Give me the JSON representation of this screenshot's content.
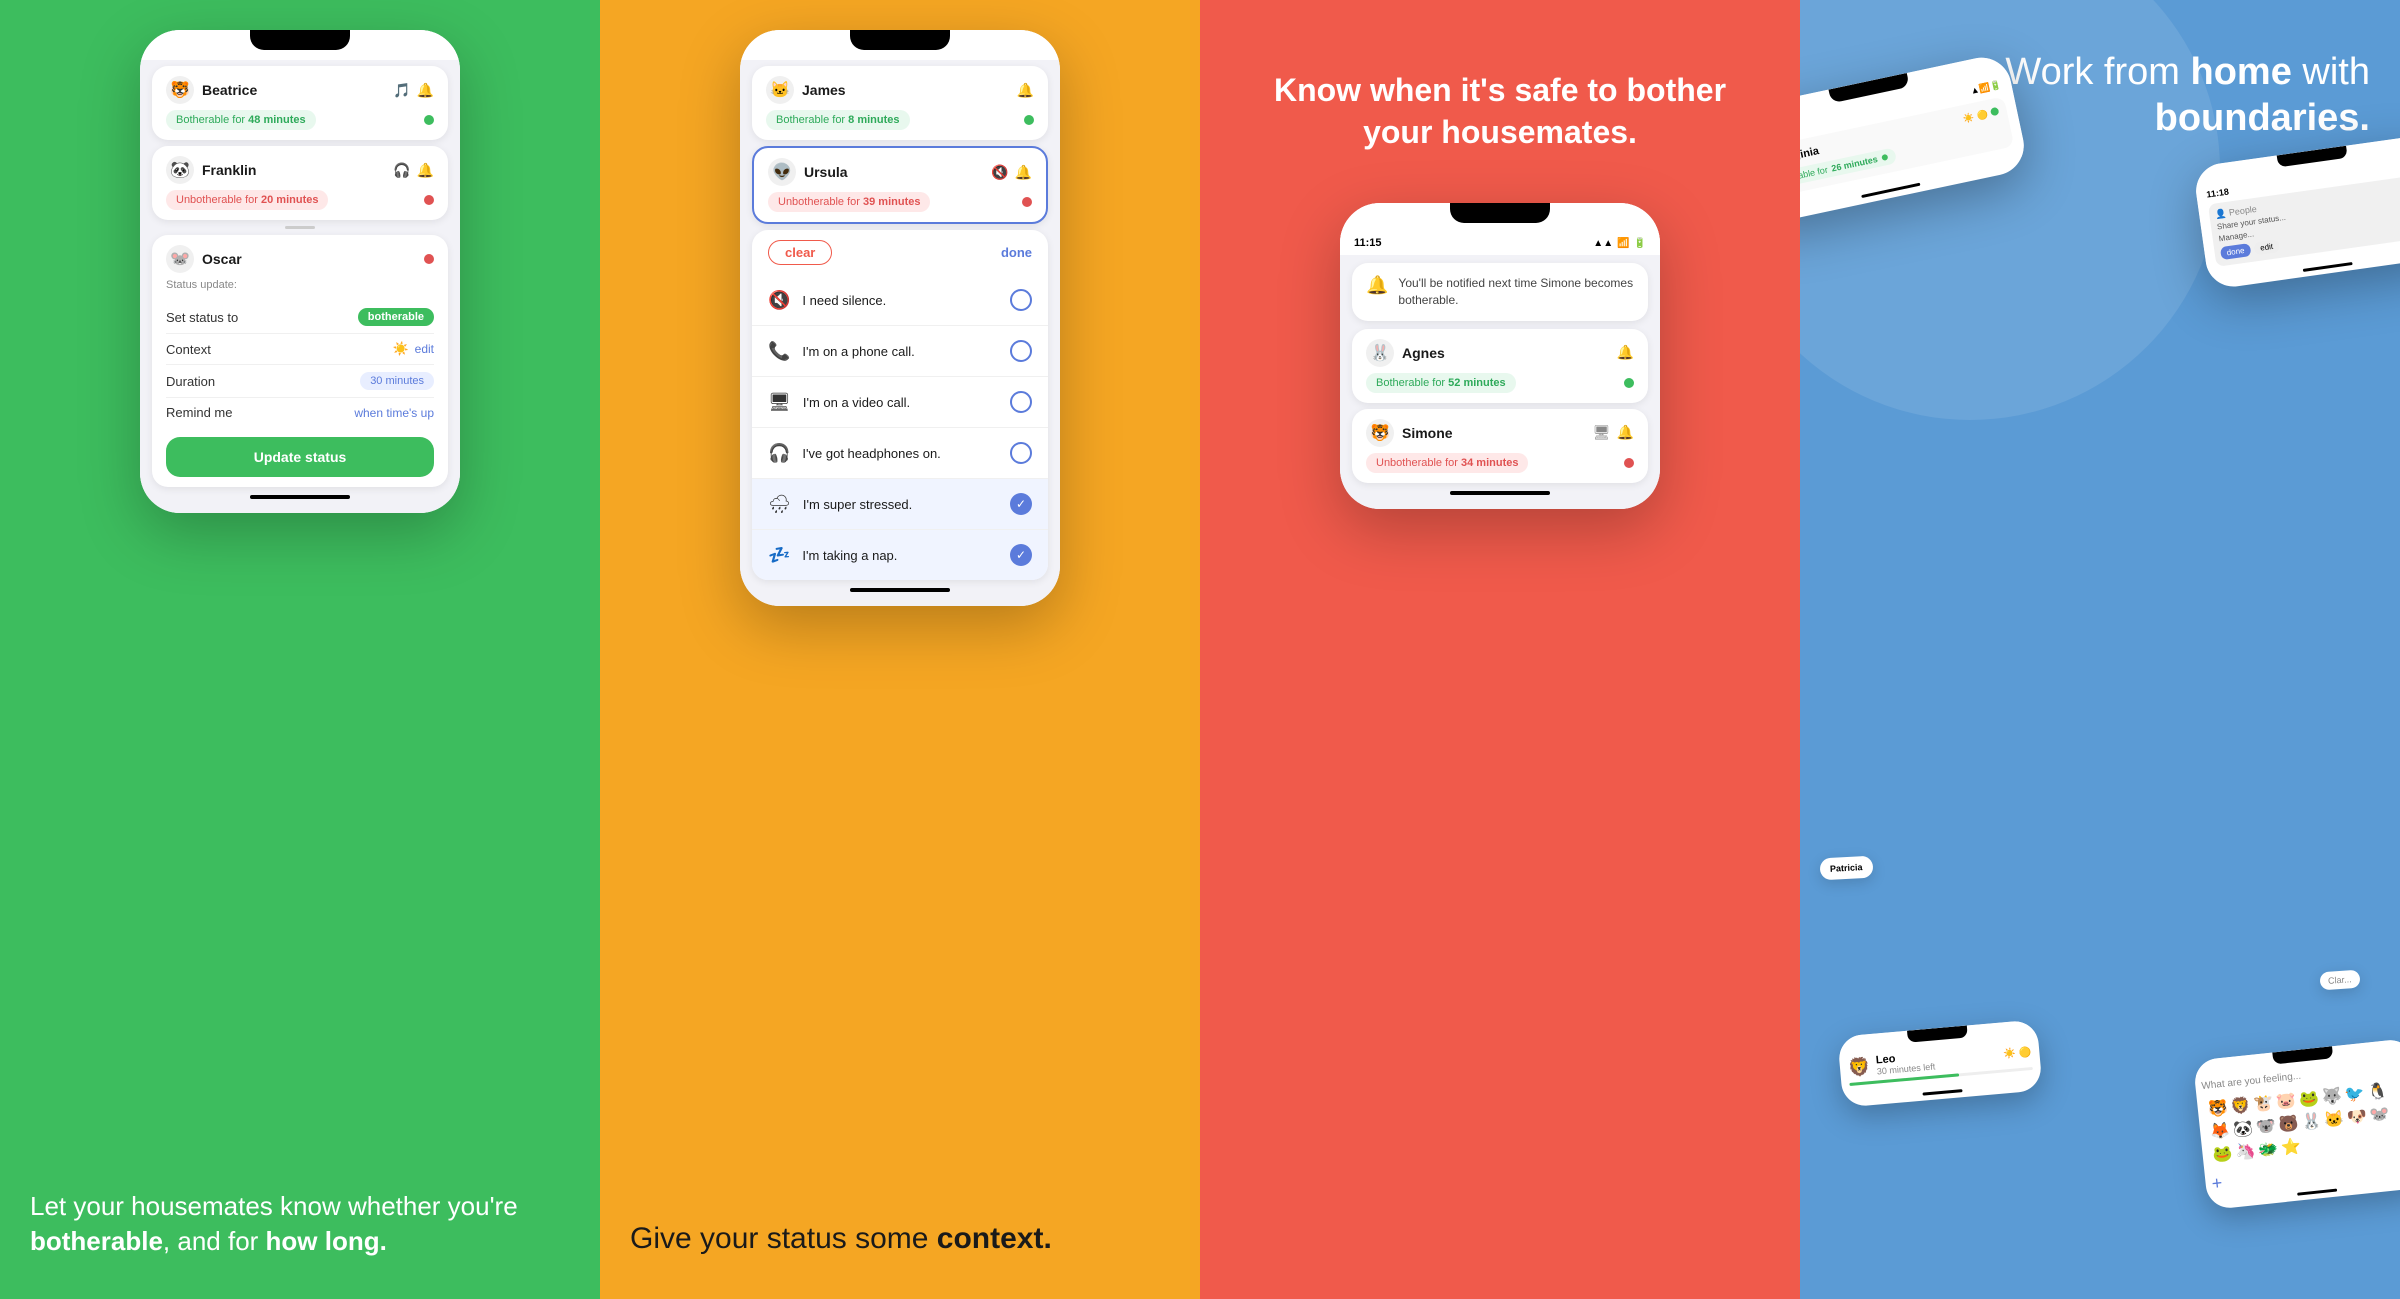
{
  "panels": [
    {
      "id": "panel-1",
      "bg": "#3DBD5E",
      "caption": {
        "text_plain": "Let your housemates know whether you're ",
        "text_bold_1": "botherable",
        "text_mid": ", and for ",
        "text_bold_2": "how long."
      },
      "phone": {
        "contacts": [
          {
            "name": "Beatrice",
            "avatar": "🐯",
            "status": "botherable",
            "duration": "48 minutes",
            "icons": [
              "🎵",
              "🔔"
            ]
          },
          {
            "name": "Franklin",
            "avatar": "🐼",
            "status": "unbotherable",
            "duration": "20 minutes",
            "icons": [
              "🎧",
              "🔔"
            ]
          }
        ],
        "form": {
          "label": "Status update:",
          "set_status_label": "Set status to",
          "set_status_value": "botherable",
          "context_label": "Context",
          "context_icon": "☀️",
          "context_action": "edit",
          "duration_label": "Duration",
          "duration_value": "30 minutes",
          "remind_label": "Remind me",
          "remind_value": "when time's up",
          "update_btn": "Update status"
        },
        "oscar": {
          "name": "Oscar",
          "avatar": "🐭"
        }
      }
    },
    {
      "id": "panel-2",
      "bg": "#F5A623",
      "caption": {
        "text_plain": "Give your status some ",
        "text_bold": "context."
      },
      "phone": {
        "top_contact": {
          "name": "James",
          "avatar": "🐱",
          "status": "botherable",
          "duration": "8 minutes"
        },
        "bottom_contact": {
          "name": "Ursula",
          "avatar": "👽",
          "status": "unbotherable",
          "duration": "39 minutes"
        },
        "clear_btn": "clear",
        "done_btn": "done",
        "context_items": [
          {
            "icon": "🔇",
            "text": "I need silence.",
            "checked": false
          },
          {
            "icon": "📞",
            "text": "I'm on a phone call.",
            "checked": false
          },
          {
            "icon": "🖥",
            "text": "I'm on a video call.",
            "checked": false
          },
          {
            "icon": "🎧",
            "text": "I've got headphones on.",
            "checked": false
          },
          {
            "icon": "🌧",
            "text": "I'm super stressed.",
            "checked": true
          },
          {
            "icon": "💤",
            "text": "I'm taking a nap.",
            "checked": true
          }
        ]
      }
    },
    {
      "id": "panel-3",
      "bg": "#F05A4B",
      "caption": {
        "text_plain": "Know when it's safe to bother your housemates."
      },
      "phone": {
        "time": "11:15",
        "notification": "You'll be notified next time Simone becomes botherable.",
        "contacts": [
          {
            "name": "Agnes",
            "avatar": "🐰",
            "status": "botherable",
            "duration": "52 minutes",
            "icons": [
              "🔔"
            ]
          },
          {
            "name": "Simone",
            "avatar": "🐯",
            "status": "unbotherable",
            "duration": "34 minutes",
            "icons": [
              "🖥",
              "🔔"
            ]
          }
        ]
      }
    },
    {
      "id": "panel-4",
      "bg": "#5B9BD5",
      "caption": {
        "text_1": "Work from ",
        "text_bold_1": "home",
        "text_2": " with ",
        "text_bold_2": "boundaries."
      },
      "phones": [
        {
          "name": "Virginia",
          "status": "botherable",
          "duration": "26 minutes"
        },
        {
          "name": "Leo",
          "time": "30 minutes left",
          "screen": "people"
        }
      ]
    }
  ]
}
